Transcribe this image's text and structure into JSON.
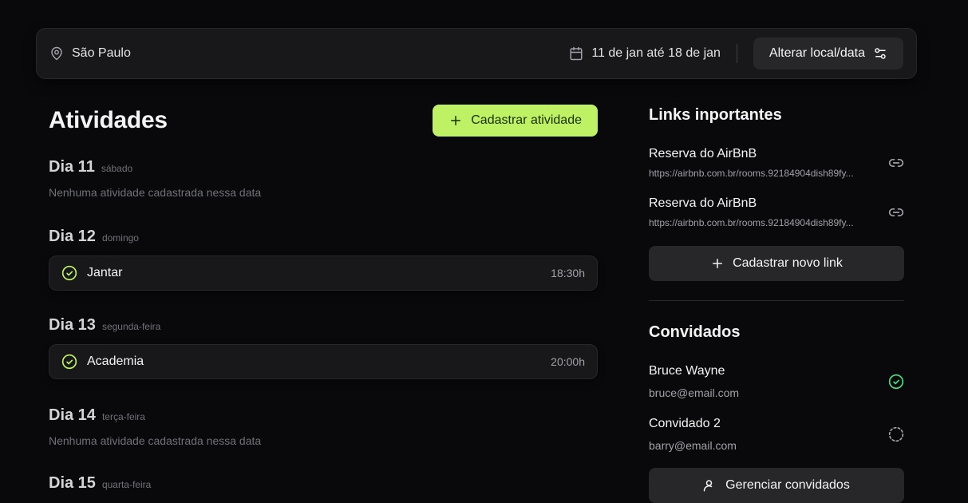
{
  "header": {
    "location": "São Paulo",
    "dates": "11 de jan até 18 de jan",
    "change_button": "Alterar local/data"
  },
  "activities": {
    "title": "Atividades",
    "add_button": "Cadastrar atividade",
    "days": [
      {
        "title": "Dia 11",
        "weekday": "sábado",
        "empty_text": "Nenhuma atividade cadastrada nessa data"
      },
      {
        "title": "Dia 12",
        "weekday": "domingo",
        "item": {
          "name": "Jantar",
          "time": "18:30h"
        }
      },
      {
        "title": "Dia 13",
        "weekday": "segunda-feira",
        "item": {
          "name": "Academia",
          "time": "20:00h"
        }
      },
      {
        "title": "Dia 14",
        "weekday": "terça-feira",
        "empty_text": "Nenhuma atividade cadastrada nessa data"
      },
      {
        "title": "Dia 15",
        "weekday": "quarta-feira"
      }
    ]
  },
  "links": {
    "title": "Links inportantes",
    "items": [
      {
        "title": "Reserva do AirBnB",
        "url": "https://airbnb.com.br/rooms.92184904dish89fy..."
      },
      {
        "title": "Reserva do AirBnB",
        "url": "https://airbnb.com.br/rooms.92184904dish89fy..."
      }
    ],
    "add_button": "Cadastrar novo link"
  },
  "guests": {
    "title": "Convidados",
    "items": [
      {
        "name": "Bruce Wayne",
        "email": "bruce@email.com",
        "status": "confirmed"
      },
      {
        "name": "Convidado 2",
        "email": "barry@email.com",
        "status": "pending"
      }
    ],
    "manage_button": "Gerenciar convidados"
  },
  "colors": {
    "background": "#09090b",
    "surface": "#18181b",
    "accent": "#bef264",
    "confirmed": "#bef264"
  },
  "icons": {
    "location": "map-pin-icon",
    "calendar": "calendar-icon",
    "settings": "settings-sliders-icon",
    "plus": "plus-icon",
    "check": "circle-check-icon",
    "link": "link-icon",
    "pending": "circle-dashed-icon",
    "user": "user-cog-icon"
  }
}
